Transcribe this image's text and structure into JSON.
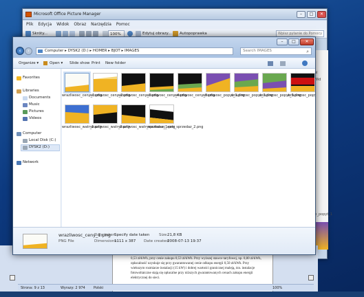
{
  "picture_manager": {
    "title": "Microsoft Office Picture Manager",
    "menu": [
      "Plik",
      "Edycja",
      "Widok",
      "Obraz",
      "Narzędzia",
      "Pomoc"
    ],
    "toolbar": {
      "shortcuts": "Skróty...",
      "zoom": "100%",
      "edit": "Edytuj obrazy...",
      "autocorrect": "Autopoprawka"
    },
    "help_placeholder": "Wpisz pytanie do Pomocy",
    "side_labels": [
      "pl",
      "Wid"
    ],
    "thumb_label": "ie_popyt_1"
  },
  "word": {
    "doc_text": "0,53 zł/kWh, przy cenie zakupu 0,53 zł/kWh. Przy wyższej stawce taryfowej, np. 0,80 zł/kWh, opłacalność uzyskuje się przy gwarantowanej cenie odkupu energii 0,50 zł/kWh. Przy wiekszym rozmiarze instalacji (15 kW) i dobrej wartości granicznej maleją, tzn. instalacje fotowoltaiczne stają się opłacalne przy niższych gwarantowanych cenach zakupu energii elektrycznej do sieci.",
    "status": {
      "page": "Strona: 9 z 13",
      "words": "Wyrazy: 2 974",
      "lang": "Polski",
      "zoom": "100%"
    }
  },
  "explorer": {
    "controls": {
      "minimize": "–",
      "maximize": "□",
      "close": "✕"
    },
    "address": [
      "Computer",
      "DYSK2 (D:)",
      "HOMER",
      "BJOT",
      "IMAGES"
    ],
    "search_placeholder": "Search IMAGES",
    "commands": [
      "Organize ▾",
      "Open ▾",
      "Slide show",
      "Print",
      "New folder"
    ],
    "nav": {
      "favorites": "Favorites",
      "libraries": "Libraries",
      "documents": "Documents",
      "music": "Music",
      "pictures": "Pictures",
      "videos": "Videos",
      "computer": "Computer",
      "local_disk": "Local Disk (C:)",
      "dysk2": "DYSK2 (D:)",
      "network": "Network"
    },
    "files": [
      {
        "name": "wrazliwosc_ceny_1.png",
        "style": "white-yellow",
        "selected": true
      },
      {
        "name": "wrazliwosc_ceny_2.png",
        "style": "yellow"
      },
      {
        "name": "wrazliwosc_ceny_3.png",
        "style": "black-yellow"
      },
      {
        "name": "wrazliwosc_ceny_4.png",
        "style": "black-green"
      },
      {
        "name": "wrazliwosc_ceny_5.png",
        "style": "black-green2"
      },
      {
        "name": "wrazliwosc_popyt_1.png",
        "style": "purple-yellow"
      },
      {
        "name": "wrazliwosc_popyt_2.png",
        "style": "purple-green"
      },
      {
        "name": "wrazliwosc_popyt_3.png",
        "style": "green-purple"
      },
      {
        "name": "wrazliwosc_popyt_4.png",
        "style": "red-black"
      },
      {
        "name": "wrazliwosc_watr_1.png",
        "style": "blue-yellow"
      },
      {
        "name": "wrazliwosc_watr_2.png",
        "style": "yellow-black"
      },
      {
        "name": "wrazliwosc_watr_sprzedaz_1.png",
        "style": "black-yellow2"
      },
      {
        "name": "wrazliwosc_watr_sprzedaz_2.png",
        "style": "black-white"
      }
    ],
    "details": {
      "filename": "wrazliwosc_ceny_1.png",
      "filetype": "PNG File",
      "date_taken_label": "Date taken:",
      "date_taken": "Specify date taken",
      "dimensions_label": "Dimensions:",
      "dimensions": "1111 x 387",
      "size_label": "Size:",
      "size": "21,8 KB",
      "created_label": "Date created:",
      "created": "2008-07-13 19:37"
    }
  },
  "colors": {
    "yellow": "#f0b323",
    "purple": "#7a4fb1",
    "green": "#6aa84f",
    "black": "#111111",
    "red": "#cc1111",
    "blue": "#3d6fd1"
  }
}
